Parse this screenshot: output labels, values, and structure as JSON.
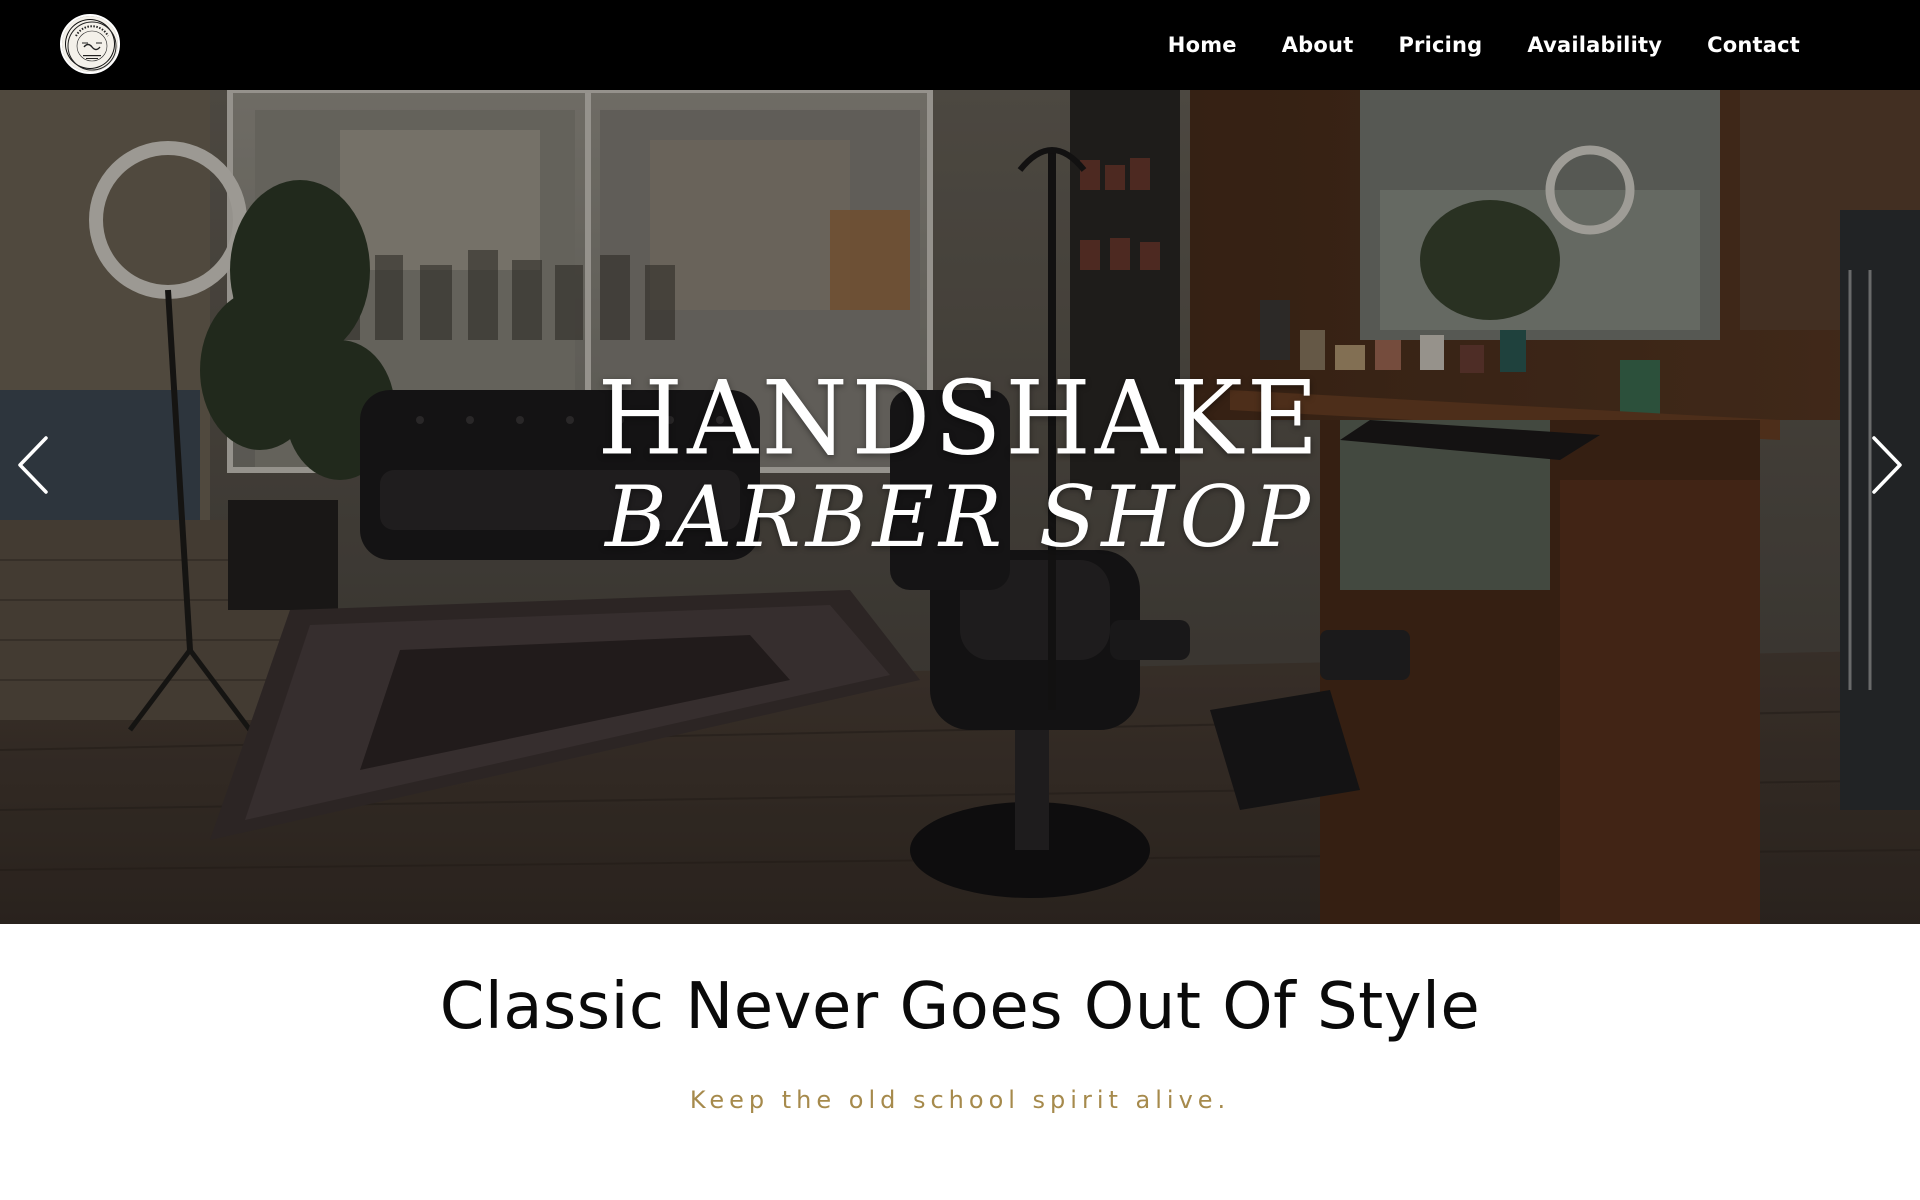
{
  "header": {
    "logo": {
      "icon": "barbershop-seal-logo",
      "text": "HANDSHAKE BARBER SHOP"
    },
    "nav": [
      {
        "label": "Home"
      },
      {
        "label": "About"
      },
      {
        "label": "Pricing"
      },
      {
        "label": "Availability"
      },
      {
        "label": "Contact"
      }
    ]
  },
  "hero": {
    "title": "HANDSHAKE",
    "subtitle": "BARBER SHOP",
    "prev_icon": "chevron-left-icon",
    "next_icon": "chevron-right-icon"
  },
  "content": {
    "headline": "Classic Never Goes Out Of Style",
    "tagline": "Keep the old school spirit alive."
  },
  "colors": {
    "nav_background": "#000000",
    "nav_text": "#ffffff",
    "headline": "#0a0a0a",
    "tagline_accent": "#a68a4c"
  }
}
